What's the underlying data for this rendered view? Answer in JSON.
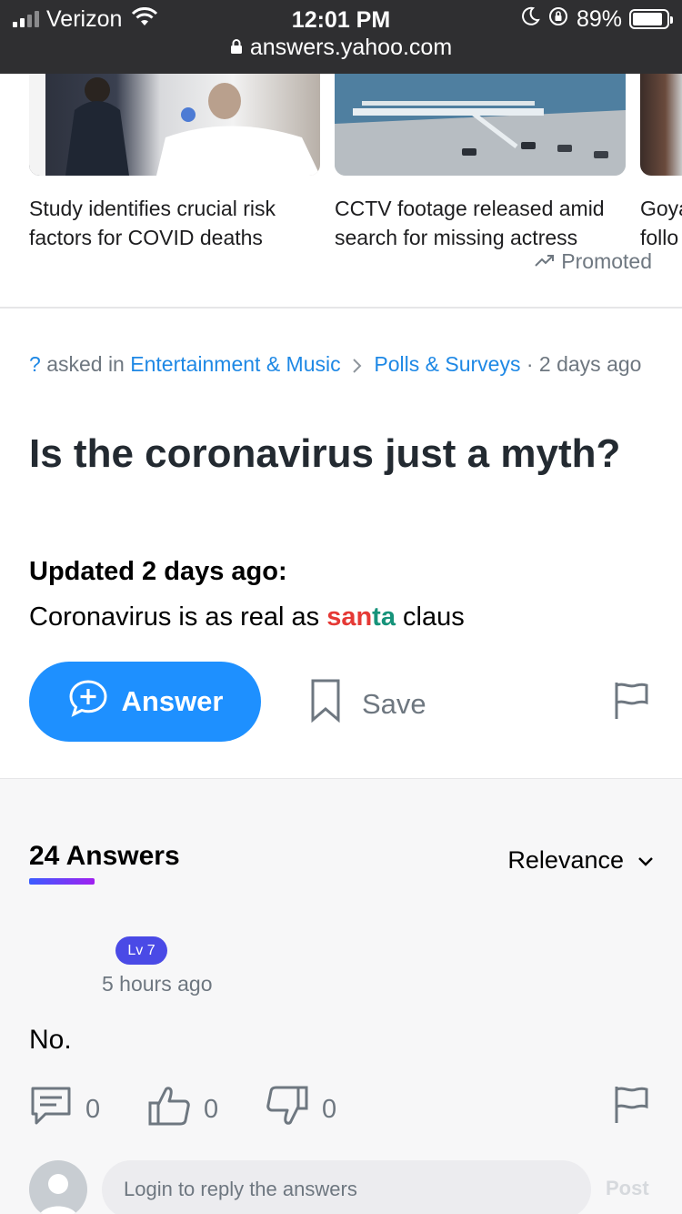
{
  "status_bar": {
    "carrier": "Verizon",
    "time": "12:01 PM",
    "battery_percent": "89%",
    "battery_level": 0.89,
    "url": "answers.yahoo.com"
  },
  "carousel": {
    "cards": [
      {
        "title": "Study identifies crucial risk factors for COVID deaths"
      },
      {
        "title": "CCTV footage released amid search for missing actress"
      },
      {
        "title": "Goya follo"
      }
    ],
    "promoted_label": "Promoted"
  },
  "question": {
    "asker": "?",
    "asked_in_text": "asked in",
    "category": "Entertainment & Music",
    "subcategory": "Polls & Surveys",
    "age": "· 2 days ago",
    "title": "Is the coronavirus just a myth?",
    "update_label": "Updated 2 days ago:",
    "update_text_before": "Coronavirus is as real as ",
    "update_text_red": "san",
    "update_text_green": "ta",
    "update_text_after": " claus"
  },
  "actions": {
    "answer_label": "Answer",
    "save_label": "Save"
  },
  "answers": {
    "count_label": "24 Answers",
    "sort_label": "Relevance",
    "items": [
      {
        "level": "Lv 7",
        "time": "5 hours ago",
        "body": "No.",
        "comments": "0",
        "likes": "0",
        "dislikes": "0"
      }
    ]
  },
  "reply": {
    "placeholder": "Login to reply the answers",
    "post_label": "Post"
  },
  "colors": {
    "accent_blue": "#1e90ff",
    "link_blue": "#1e88e5",
    "badge_purple": "#4a4ae6",
    "santa_red": "#e53935",
    "santa_green": "#16937a"
  }
}
